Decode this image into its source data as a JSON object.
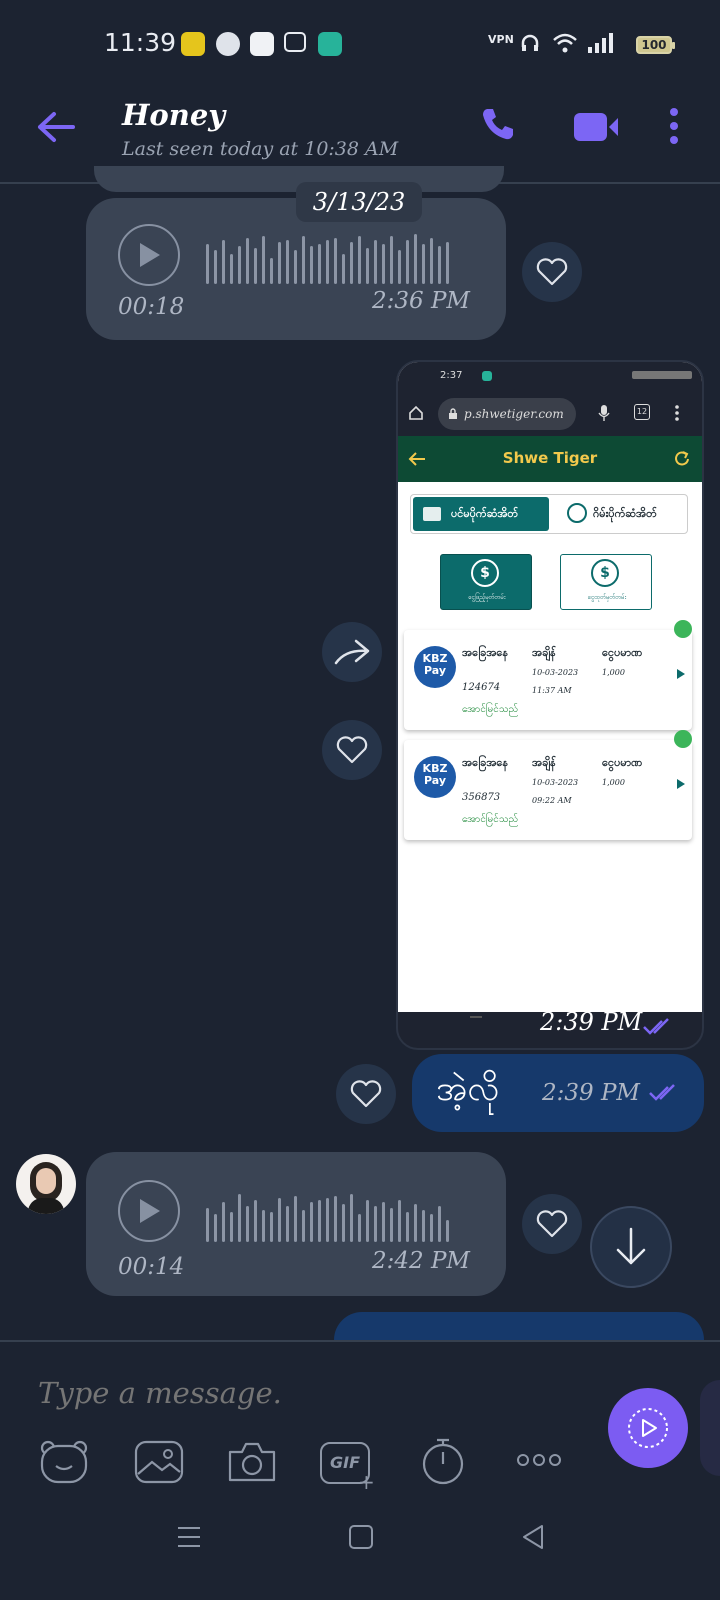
{
  "status_bar": {
    "time": "11:39",
    "battery": "100"
  },
  "header": {
    "contact_name": "Honey",
    "last_seen": "Last seen today at 10:38 AM"
  },
  "chat": {
    "date_label": "3/13/23",
    "voice1": {
      "duration": "00:18",
      "time": "2:36 PM"
    },
    "screenshot": {
      "status_time": "2:37",
      "url": "p.shwetiger.com",
      "tab_count": "12",
      "app_title": "Shwe Tiger",
      "tab_active": "ပင်မပိုက်ဆံအိတ်",
      "tab_inactive": "ဂိမ်းပိုက်ဆံအိတ်",
      "deposit_label": "ငွေဖြည့်မှတ်တမ်း",
      "withdraw_label": "ငွေထုတ်မှတ်တမ်း",
      "records": [
        {
          "col1": "အခြေအနေ",
          "col2": "အချိန်",
          "col3": "ငွေပမာဏ",
          "id": "124674",
          "date": "10-03-2023",
          "time": "11:37 AM",
          "amount": "1,000",
          "status": "အောင်မြင်သည်"
        },
        {
          "col1": "အခြေအနေ",
          "col2": "အချိန်",
          "col3": "ငွေပမာဏ",
          "id": "356873",
          "date": "10-03-2023",
          "time": "09:22 AM",
          "amount": "1,000",
          "status": "အောင်မြင်သည်"
        }
      ],
      "kbz_label": "KBZ",
      "pay_label": "Pay",
      "time": "2:39 PM"
    },
    "text_msg": {
      "text": "အဲ့လို",
      "time": "2:39 PM"
    },
    "voice2": {
      "duration": "00:14",
      "time": "2:42 PM"
    }
  },
  "input": {
    "placeholder": "Type a message."
  },
  "toolbar": {
    "gif_label": "GIF"
  }
}
